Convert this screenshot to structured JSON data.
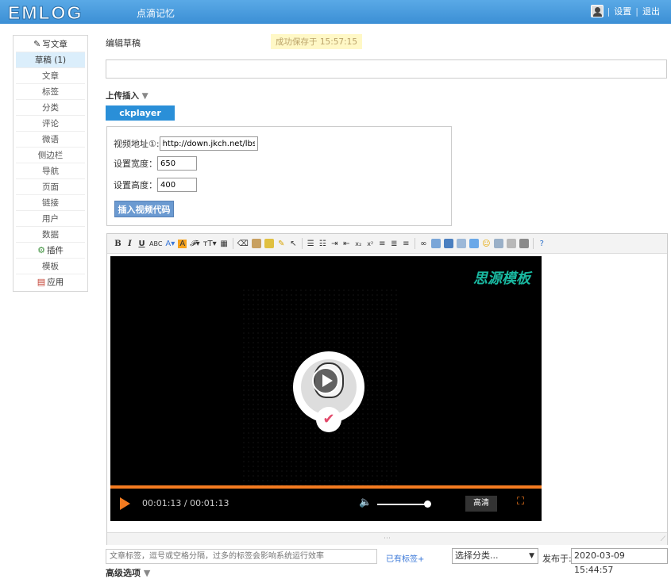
{
  "header": {
    "logo": "EMLOG",
    "site_name": "点滴记忆",
    "settings": "设置",
    "logout": "退出",
    "separator": "|"
  },
  "sidebar": {
    "write": "写文章",
    "items": [
      "草稿 (1)",
      "文章",
      "标签",
      "分类",
      "评论",
      "微语",
      "侧边栏",
      "导航",
      "页面",
      "链接",
      "用户",
      "数据"
    ],
    "plugins": "插件",
    "templates": "模板",
    "apps": "应用"
  },
  "main": {
    "edit_title": "编辑草稿",
    "saved_msg": "成功保存于 15:57:15",
    "title_value": "",
    "upload_label": "上传插入",
    "caret": "▼",
    "ckplayer_tab": "ckplayer",
    "video_url_label": "视频地址①:",
    "video_url_value": "http://down.jkch.net/lbsj",
    "width_label": "设置宽度：",
    "width_value": "650",
    "height_label": "设置高度：",
    "height_value": "400",
    "insert_button": "插入视频代码"
  },
  "editor": {
    "brand": "思源模板",
    "time": "00:01:13 / 00:01:13",
    "hd": "高清",
    "progress_fraction": 1.0,
    "volume_fraction": 0.9
  },
  "footer": {
    "tags_placeholder": "文章标签，逗号或空格分隔，过多的标签会影响系统运行效率",
    "existing_tags": "已有标签+",
    "category": "选择分类...",
    "publish_label": "发布于:",
    "publish_date": "2020-03-09 15:44:57",
    "advanced": "高级选项"
  },
  "colors": {
    "header_blue": "#3c8fd5",
    "accent_orange": "#f47b20",
    "brand_teal": "#19b8a0"
  }
}
